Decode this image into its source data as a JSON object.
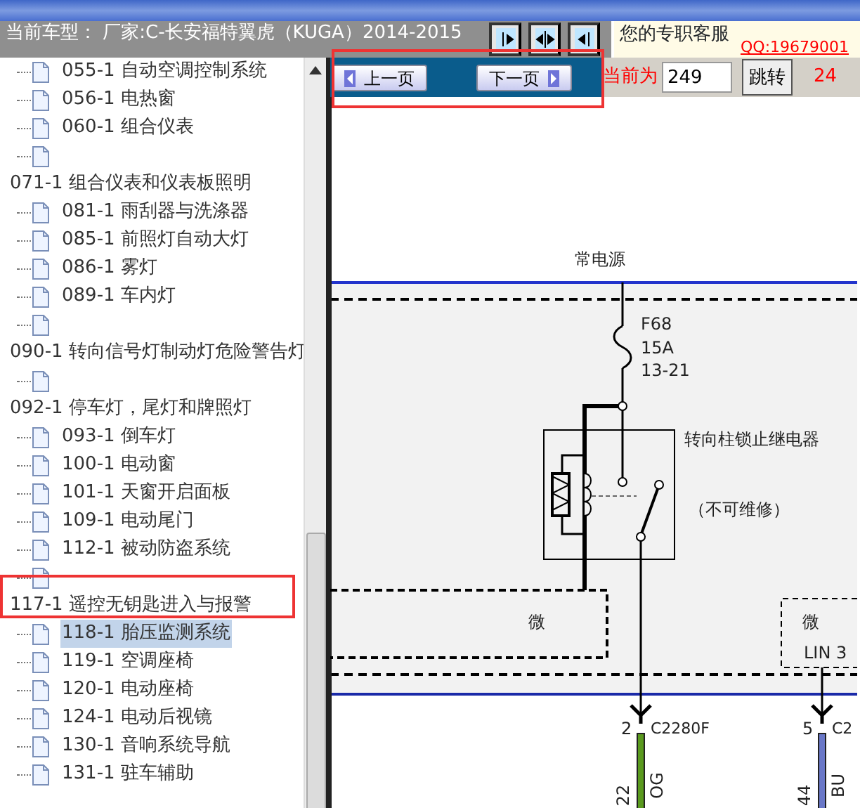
{
  "header": {
    "model": "当前车型： 厂家:C-长安福特翼虎（KUGA）2014-2015",
    "support_label": "您的专职客服",
    "support_link": "QQ:19679001"
  },
  "pager": {
    "prev": "上一页",
    "next": "下一页",
    "current_label": "当前为",
    "page_value": "249",
    "jump": "跳转",
    "total": "24"
  },
  "tree": {
    "continued_children": [
      {
        "label": "055-1 自动空调控制系统",
        "selected": false
      },
      {
        "label": "056-1 电热窗",
        "selected": false
      },
      {
        "label": "060-1 组合仪表",
        "selected": false
      },
      {
        "selected": false
      }
    ],
    "groups": [
      {
        "label": "071-1 组合仪表和仪表板照明",
        "selected": false,
        "children": [
          {
            "label": "081-1 雨刮器与洗涤器",
            "selected": false
          },
          {
            "label": "085-1 前照灯自动大灯",
            "selected": false
          },
          {
            "label": "086-1 雾灯",
            "selected": false
          },
          {
            "label": "089-1 车内灯",
            "selected": false
          },
          {
            "selected": false
          }
        ]
      },
      {
        "label": "090-1 转向信号灯制动灯危险警告灯",
        "selected": false,
        "children": [
          {
            "selected": false
          }
        ]
      },
      {
        "label": "092-1 停车灯，尾灯和牌照灯",
        "selected": false,
        "children": [
          {
            "label": "093-1 倒车灯",
            "selected": false
          },
          {
            "label": "100-1 电动窗",
            "selected": false
          },
          {
            "label": "101-1 天窗开启面板",
            "selected": false
          },
          {
            "label": "109-1 电动尾门",
            "selected": false
          },
          {
            "label": "112-1 被动防盗系统",
            "selected": false
          },
          {
            "selected": false
          }
        ]
      },
      {
        "label": "117-1 遥控无钥匙进入与报警",
        "selected": false,
        "children": [
          {
            "label": "118-1 胎压监测系统",
            "selected": true
          },
          {
            "label": "119-1 空调座椅",
            "selected": false
          },
          {
            "label": "120-1 电动座椅",
            "selected": false
          },
          {
            "label": "124-1 电动后视镜",
            "selected": false
          },
          {
            "label": "130-1 音响系统导航",
            "selected": false
          },
          {
            "label": "131-1 驻车辅助",
            "selected": false
          }
        ]
      }
    ]
  },
  "diagram": {
    "power_label": "常电源",
    "fuse": {
      "name": "F68",
      "rating": "15A",
      "location": "13-21"
    },
    "relay": {
      "name": "转向柱锁止继电器",
      "note": "（不可维修）"
    },
    "modules": [
      {
        "label": "微"
      },
      {
        "label": "微",
        "bus": "LIN 3"
      }
    ],
    "connectors": [
      {
        "pin": "2",
        "name": "C2280F",
        "wire_number": "22",
        "wire_code": "OG",
        "color": "#5a9a1e"
      },
      {
        "pin": "5",
        "name": "C2",
        "wire_number": "44",
        "wire_code": "BU",
        "color": "#6a78c8"
      }
    ]
  }
}
